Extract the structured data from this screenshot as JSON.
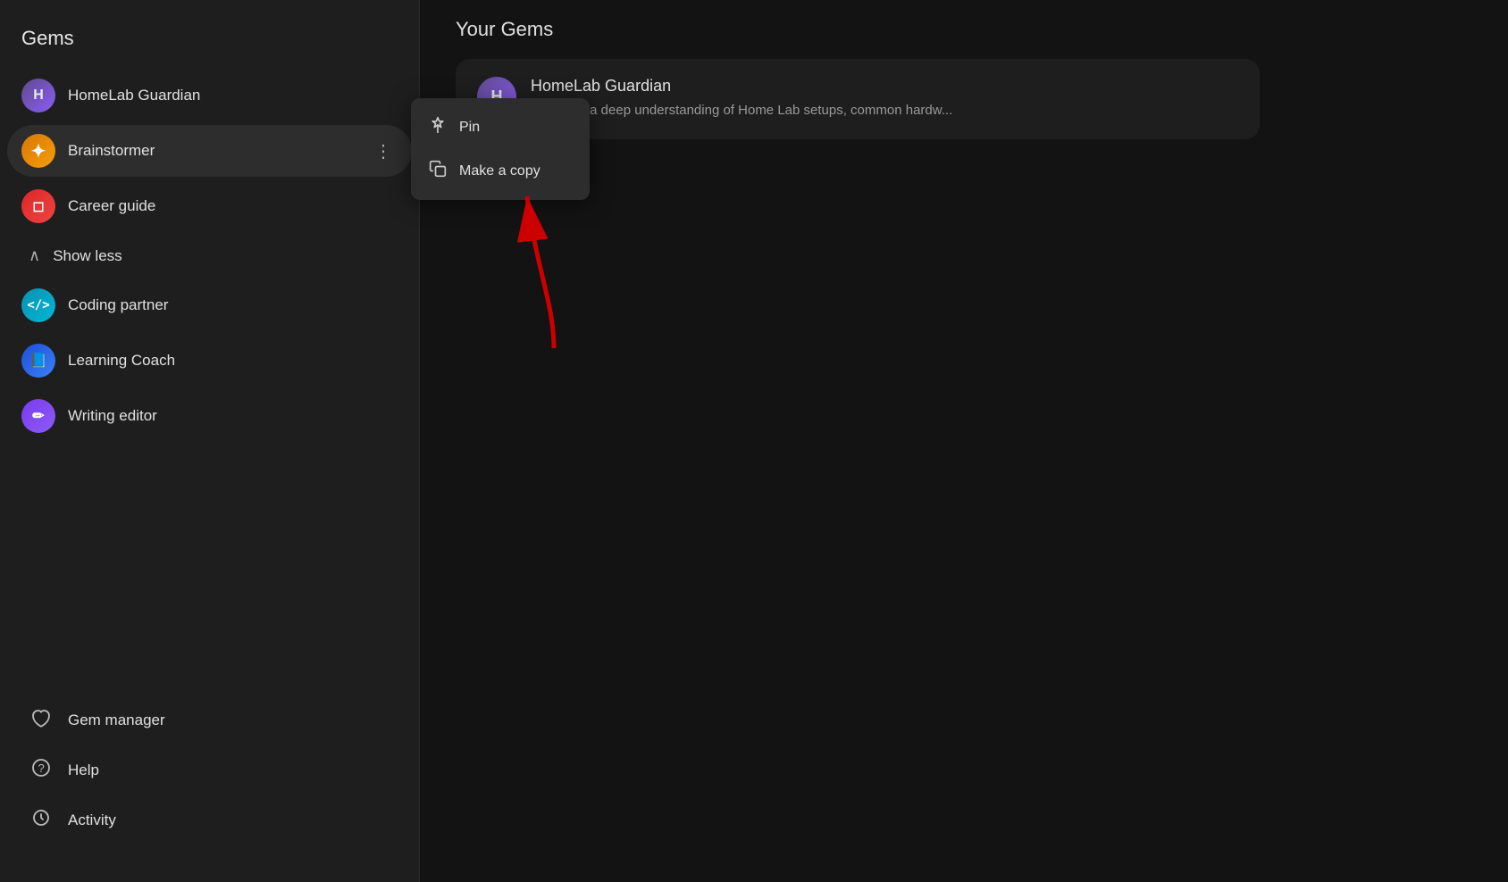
{
  "sidebar": {
    "title": "Gems",
    "items": [
      {
        "id": "homelab",
        "label": "HomeLab Guardian",
        "avatar_letter": "H",
        "avatar_class": "avatar-h",
        "has_more": false
      },
      {
        "id": "brainstormer",
        "label": "Brainstormer",
        "avatar_letter": "✦",
        "avatar_class": "avatar-b",
        "has_more": true
      },
      {
        "id": "career",
        "label": "Career guide",
        "avatar_letter": "◻",
        "avatar_class": "avatar-c",
        "has_more": false
      }
    ],
    "show_less_label": "Show less",
    "sub_items": [
      {
        "id": "coding",
        "label": "Coding partner",
        "icon": "</>",
        "avatar_class": "avatar-coding"
      },
      {
        "id": "learning",
        "label": "Learning Coach",
        "icon": "📘",
        "avatar_class": "avatar-learning"
      },
      {
        "id": "writing",
        "label": "Writing editor",
        "icon": "✏",
        "avatar_class": "avatar-writing"
      }
    ],
    "bottom_items": [
      {
        "id": "gem-manager",
        "label": "Gem manager",
        "icon": "♡"
      },
      {
        "id": "help",
        "label": "Help",
        "icon": "?"
      },
      {
        "id": "activity",
        "label": "Activity",
        "icon": "↺"
      }
    ]
  },
  "context_menu": {
    "items": [
      {
        "id": "pin",
        "label": "Pin",
        "icon": "📌"
      },
      {
        "id": "make-copy",
        "label": "Make a copy",
        "icon": "⧉"
      }
    ]
  },
  "main": {
    "title": "Your Gems",
    "gem_card": {
      "title": "HomeLab Guardian",
      "avatar_letter": "H",
      "description": "You have a deep understanding of Home Lab setups, common hardw..."
    }
  }
}
